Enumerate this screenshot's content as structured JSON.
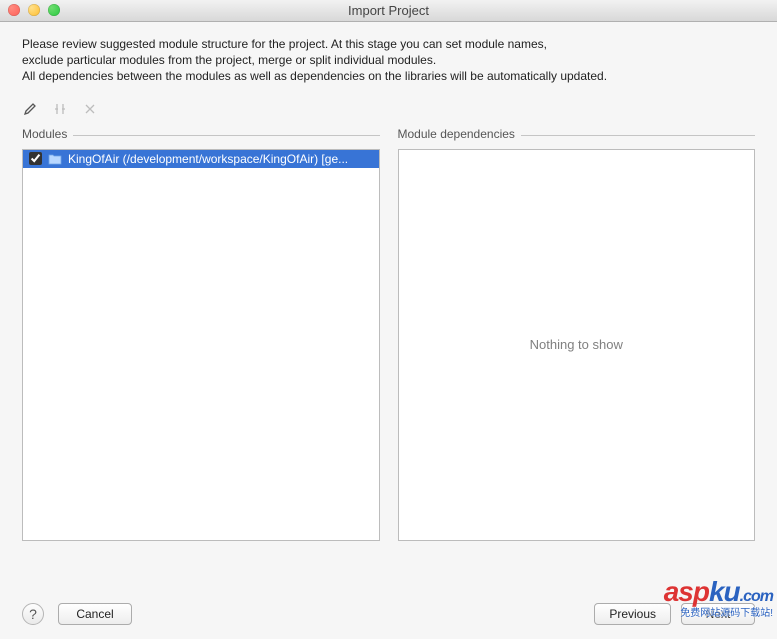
{
  "window": {
    "title": "Import Project"
  },
  "intro": {
    "line1": "Please review suggested module structure for the project. At this stage you can set module names,",
    "line2": "exclude particular modules from the project, merge or split individual modules.",
    "line3": "All dependencies between the modules as well as dependencies on the libraries will be automatically updated."
  },
  "columns": {
    "modules_header": "Modules",
    "dependencies_header": "Module dependencies"
  },
  "modules": {
    "items": [
      {
        "checked": true,
        "label": "KingOfAir (/development/workspace/KingOfAir) [ge..."
      }
    ]
  },
  "dependencies": {
    "empty_text": "Nothing to show"
  },
  "footer": {
    "help": "?",
    "cancel": "Cancel",
    "previous": "Previous",
    "next": "Next"
  },
  "watermark": {
    "domain": "aspku.com",
    "tagline": "免费网站源码下载站!"
  }
}
